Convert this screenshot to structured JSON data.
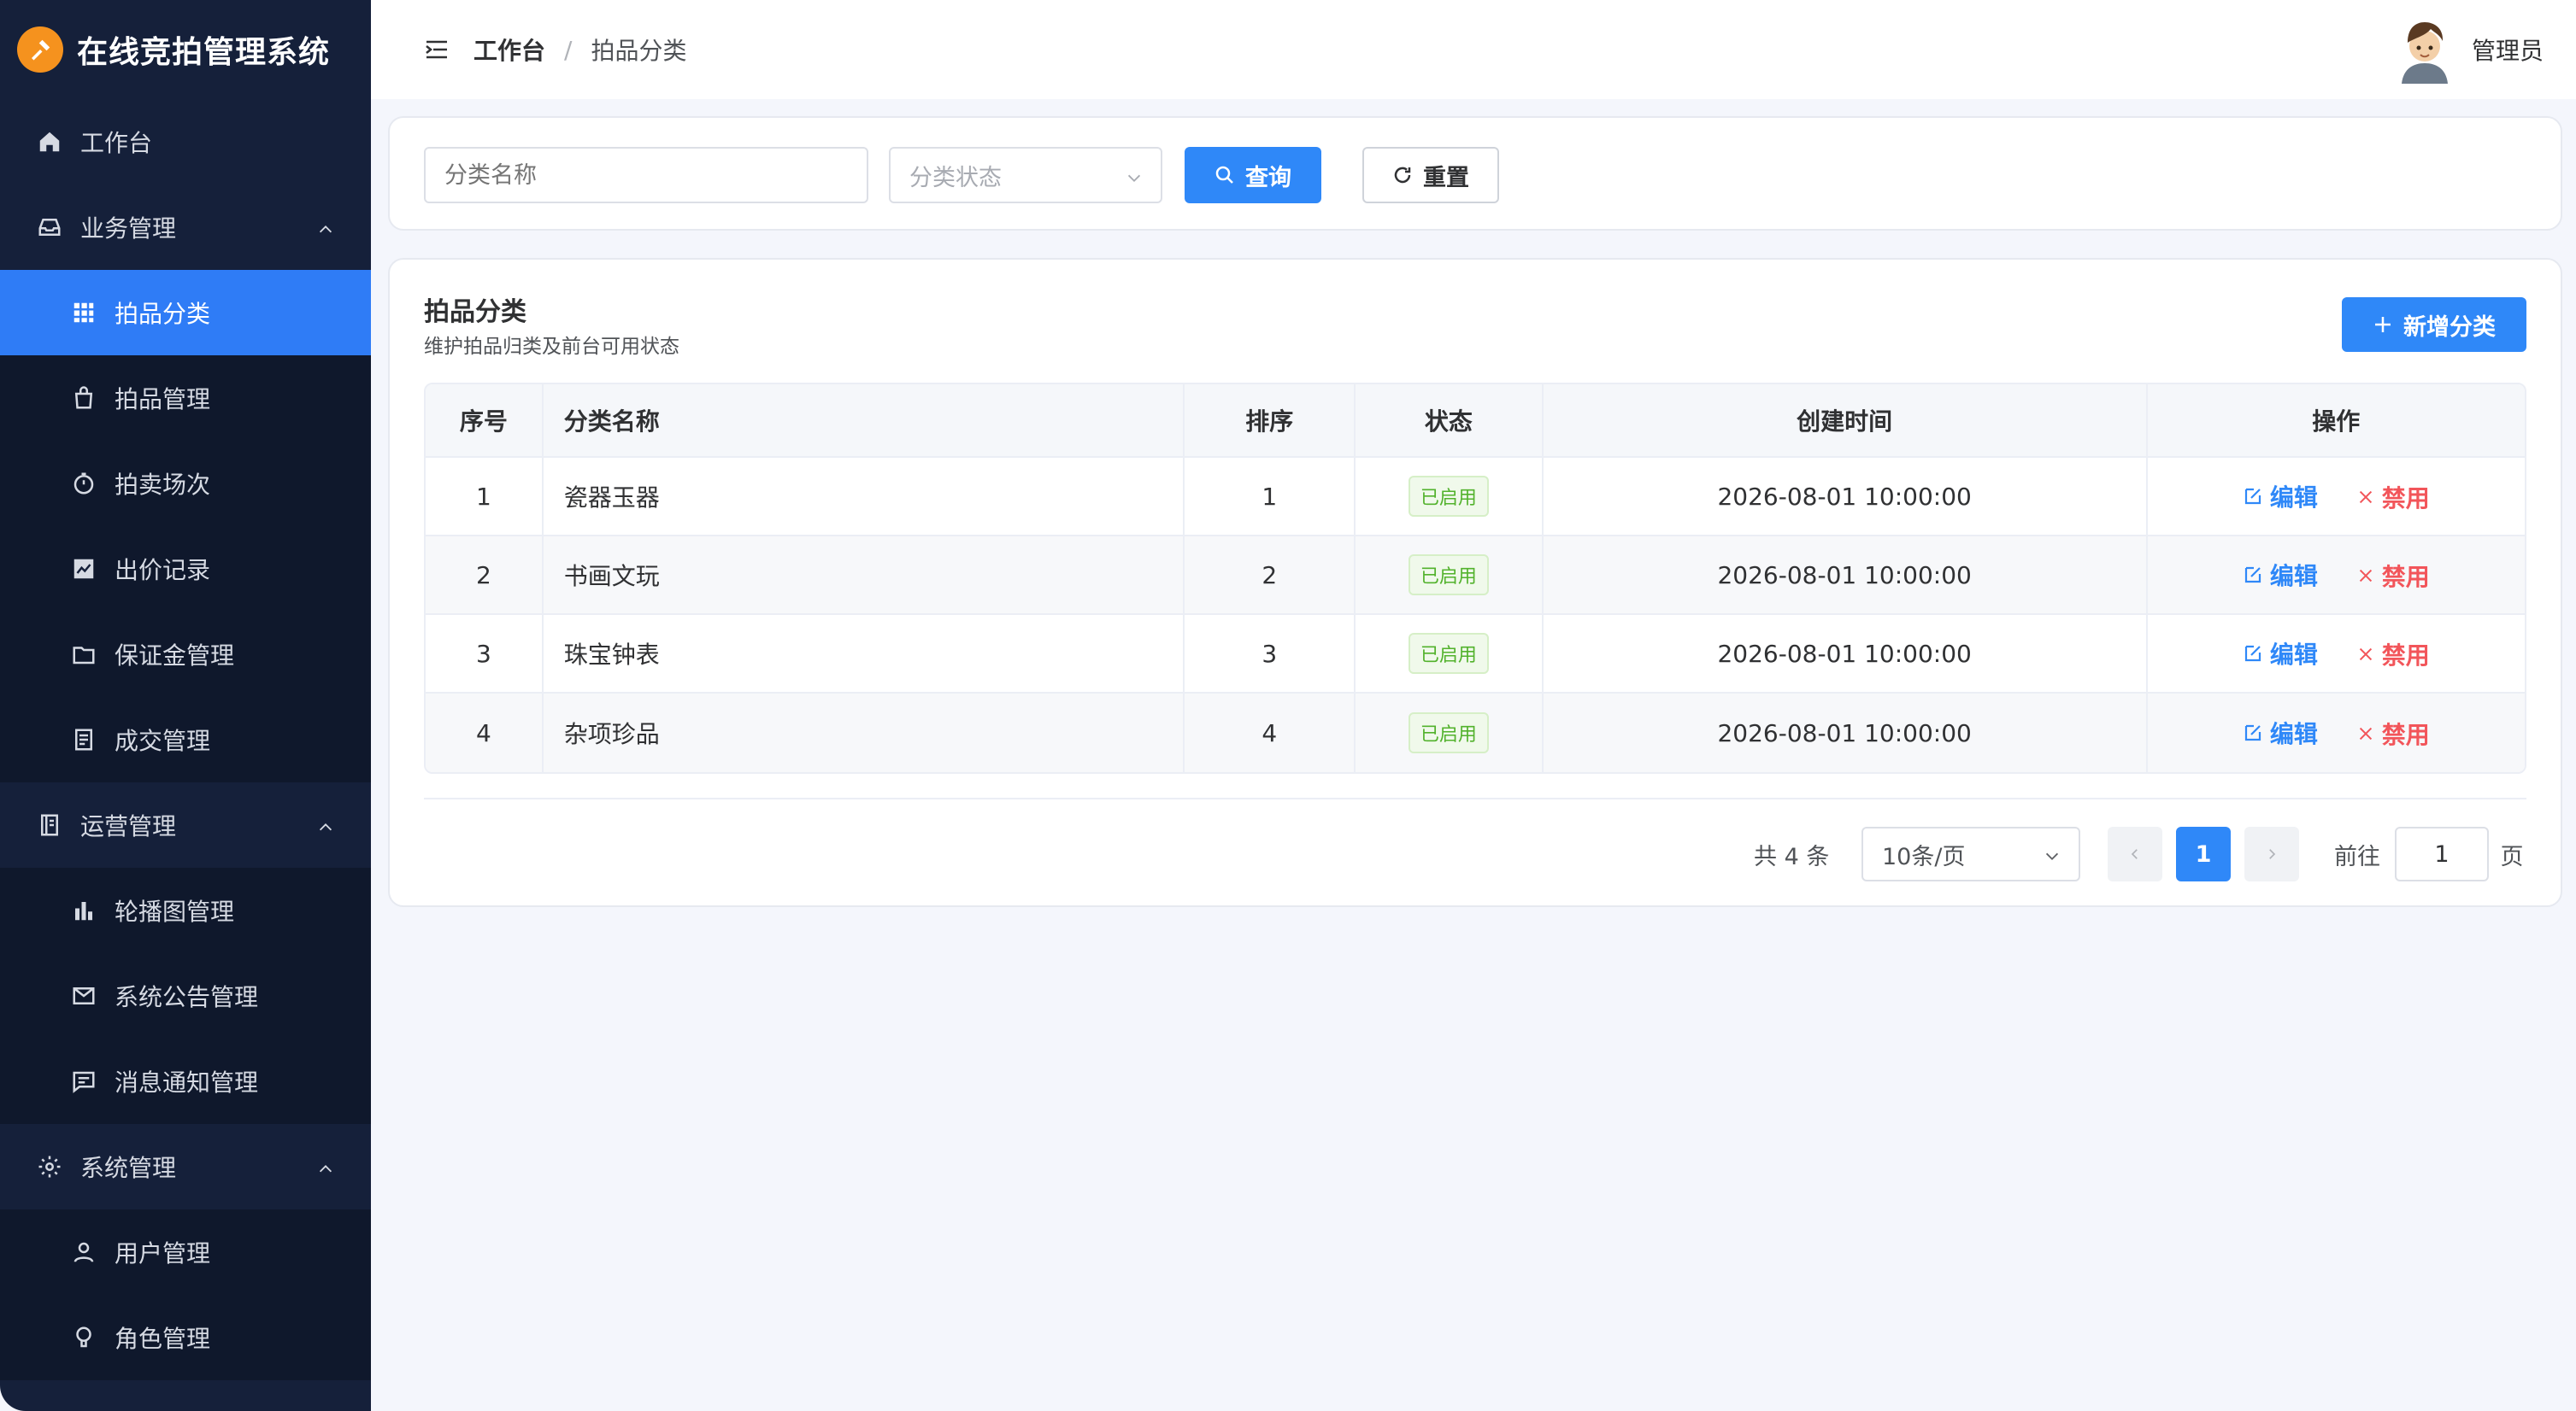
{
  "app": {
    "title": "在线竞拍管理系统"
  },
  "sidebar": {
    "items": [
      {
        "label": "工作台",
        "icon": "home-icon"
      },
      {
        "label": "业务管理",
        "icon": "inbox-icon"
      },
      {
        "label": "拍品分类",
        "icon": "grid-icon"
      },
      {
        "label": "拍品管理",
        "icon": "bag-icon"
      },
      {
        "label": "拍卖场次",
        "icon": "timer-icon"
      },
      {
        "label": "出价记录",
        "icon": "trend-chart-icon"
      },
      {
        "label": "保证金管理",
        "icon": "wallet-icon"
      },
      {
        "label": "成交管理",
        "icon": "document-icon"
      },
      {
        "label": "运营管理",
        "icon": "notebook-icon"
      },
      {
        "label": "轮播图管理",
        "icon": "bar-chart-icon"
      },
      {
        "label": "系统公告管理",
        "icon": "mail-icon"
      },
      {
        "label": "消息通知管理",
        "icon": "message-icon"
      },
      {
        "label": "系统管理",
        "icon": "gear-icon"
      },
      {
        "label": "用户管理",
        "icon": "user-icon"
      },
      {
        "label": "角色管理",
        "icon": "lightbulb-icon"
      }
    ]
  },
  "header": {
    "breadcrumb": [
      "工作台",
      "/",
      "拍品分类"
    ],
    "user_name": "管理员"
  },
  "search": {
    "name_placeholder": "分类名称",
    "status_placeholder": "分类状态",
    "query_label": "查询",
    "reset_label": "重置"
  },
  "panel": {
    "title": "拍品分类",
    "subtitle": "维护拍品归类及前台可用状态",
    "add_label": "新增分类"
  },
  "table": {
    "columns": [
      "序号",
      "分类名称",
      "排序",
      "状态",
      "创建时间",
      "操作"
    ],
    "rows": [
      {
        "index": "1",
        "name": "瓷器玉器",
        "sort": "1",
        "status": "已启用",
        "created": "2026-08-01 10:00:00",
        "edit": "编辑",
        "disable": "禁用"
      },
      {
        "index": "2",
        "name": "书画文玩",
        "sort": "2",
        "status": "已启用",
        "created": "2026-08-01 10:00:00",
        "edit": "编辑",
        "disable": "禁用"
      },
      {
        "index": "3",
        "name": "珠宝钟表",
        "sort": "3",
        "status": "已启用",
        "created": "2026-08-01 10:00:00",
        "edit": "编辑",
        "disable": "禁用"
      },
      {
        "index": "4",
        "name": "杂项珍品",
        "sort": "4",
        "status": "已启用",
        "created": "2026-08-01 10:00:00",
        "edit": "编辑",
        "disable": "禁用"
      }
    ]
  },
  "pagination": {
    "total_text": "共 4 条",
    "page_size": "10条/页",
    "current_page": "1",
    "goto_label": "前往",
    "goto_value": "1",
    "page_suffix": "页"
  },
  "colors": {
    "sidebar_bg": "#15203a",
    "accent": "#2f88f8",
    "active_menu": "#2f7cf6",
    "logo": "#f5921e",
    "success": "#52b22c",
    "danger": "#f2555a"
  }
}
